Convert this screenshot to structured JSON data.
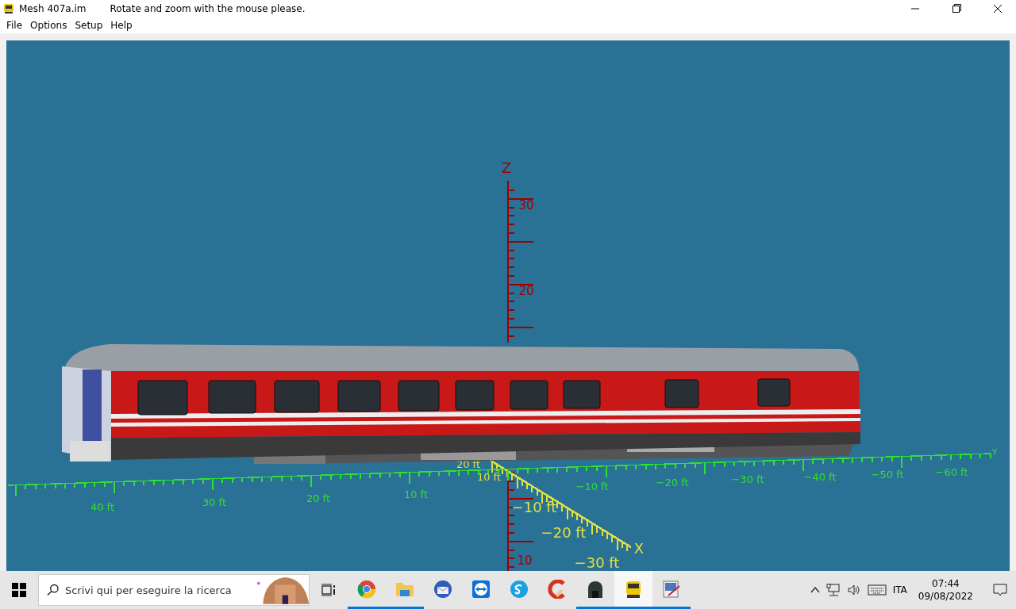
{
  "window": {
    "title": "Mesh 407a.im",
    "hint": "Rotate and zoom with the mouse please."
  },
  "menu": [
    "File",
    "Options",
    "Setup",
    "Help"
  ],
  "scene": {
    "axes": [
      {
        "kind": "z",
        "color": "#a00000",
        "name": "Z",
        "labels": [
          "30",
          "20",
          "10"
        ]
      },
      {
        "kind": "x",
        "color": "#e0e040",
        "name": "X",
        "labels": [
          "20 ft",
          "10 ft",
          "−10 ft",
          "−20 ft",
          "−30 ft"
        ]
      },
      {
        "kind": "y",
        "color": "#30e030",
        "name": "Y",
        "labels": [
          "40 ft",
          "30 ft",
          "20 ft",
          "10 ft",
          "−10 ft",
          "−20 ft",
          "−30 ft",
          "−40 ft",
          "−50 ft",
          "−60 ft"
        ]
      }
    ]
  },
  "taskbar": {
    "search": {
      "placeholder": "Scrivi qui per eseguire la ricerca"
    },
    "apps": [
      {
        "running": true,
        "selected": false
      },
      {
        "running": true,
        "selected": false
      },
      {
        "running": false,
        "selected": false
      },
      {
        "running": false,
        "selected": false
      },
      {
        "running": false,
        "selected": false
      },
      {
        "running": false,
        "selected": false
      },
      {
        "running": true,
        "selected": false
      },
      {
        "running": true,
        "selected": true
      },
      {
        "running": true,
        "selected": false
      }
    ],
    "language": "ITA",
    "time": "07:44",
    "date": "09/08/2022"
  }
}
